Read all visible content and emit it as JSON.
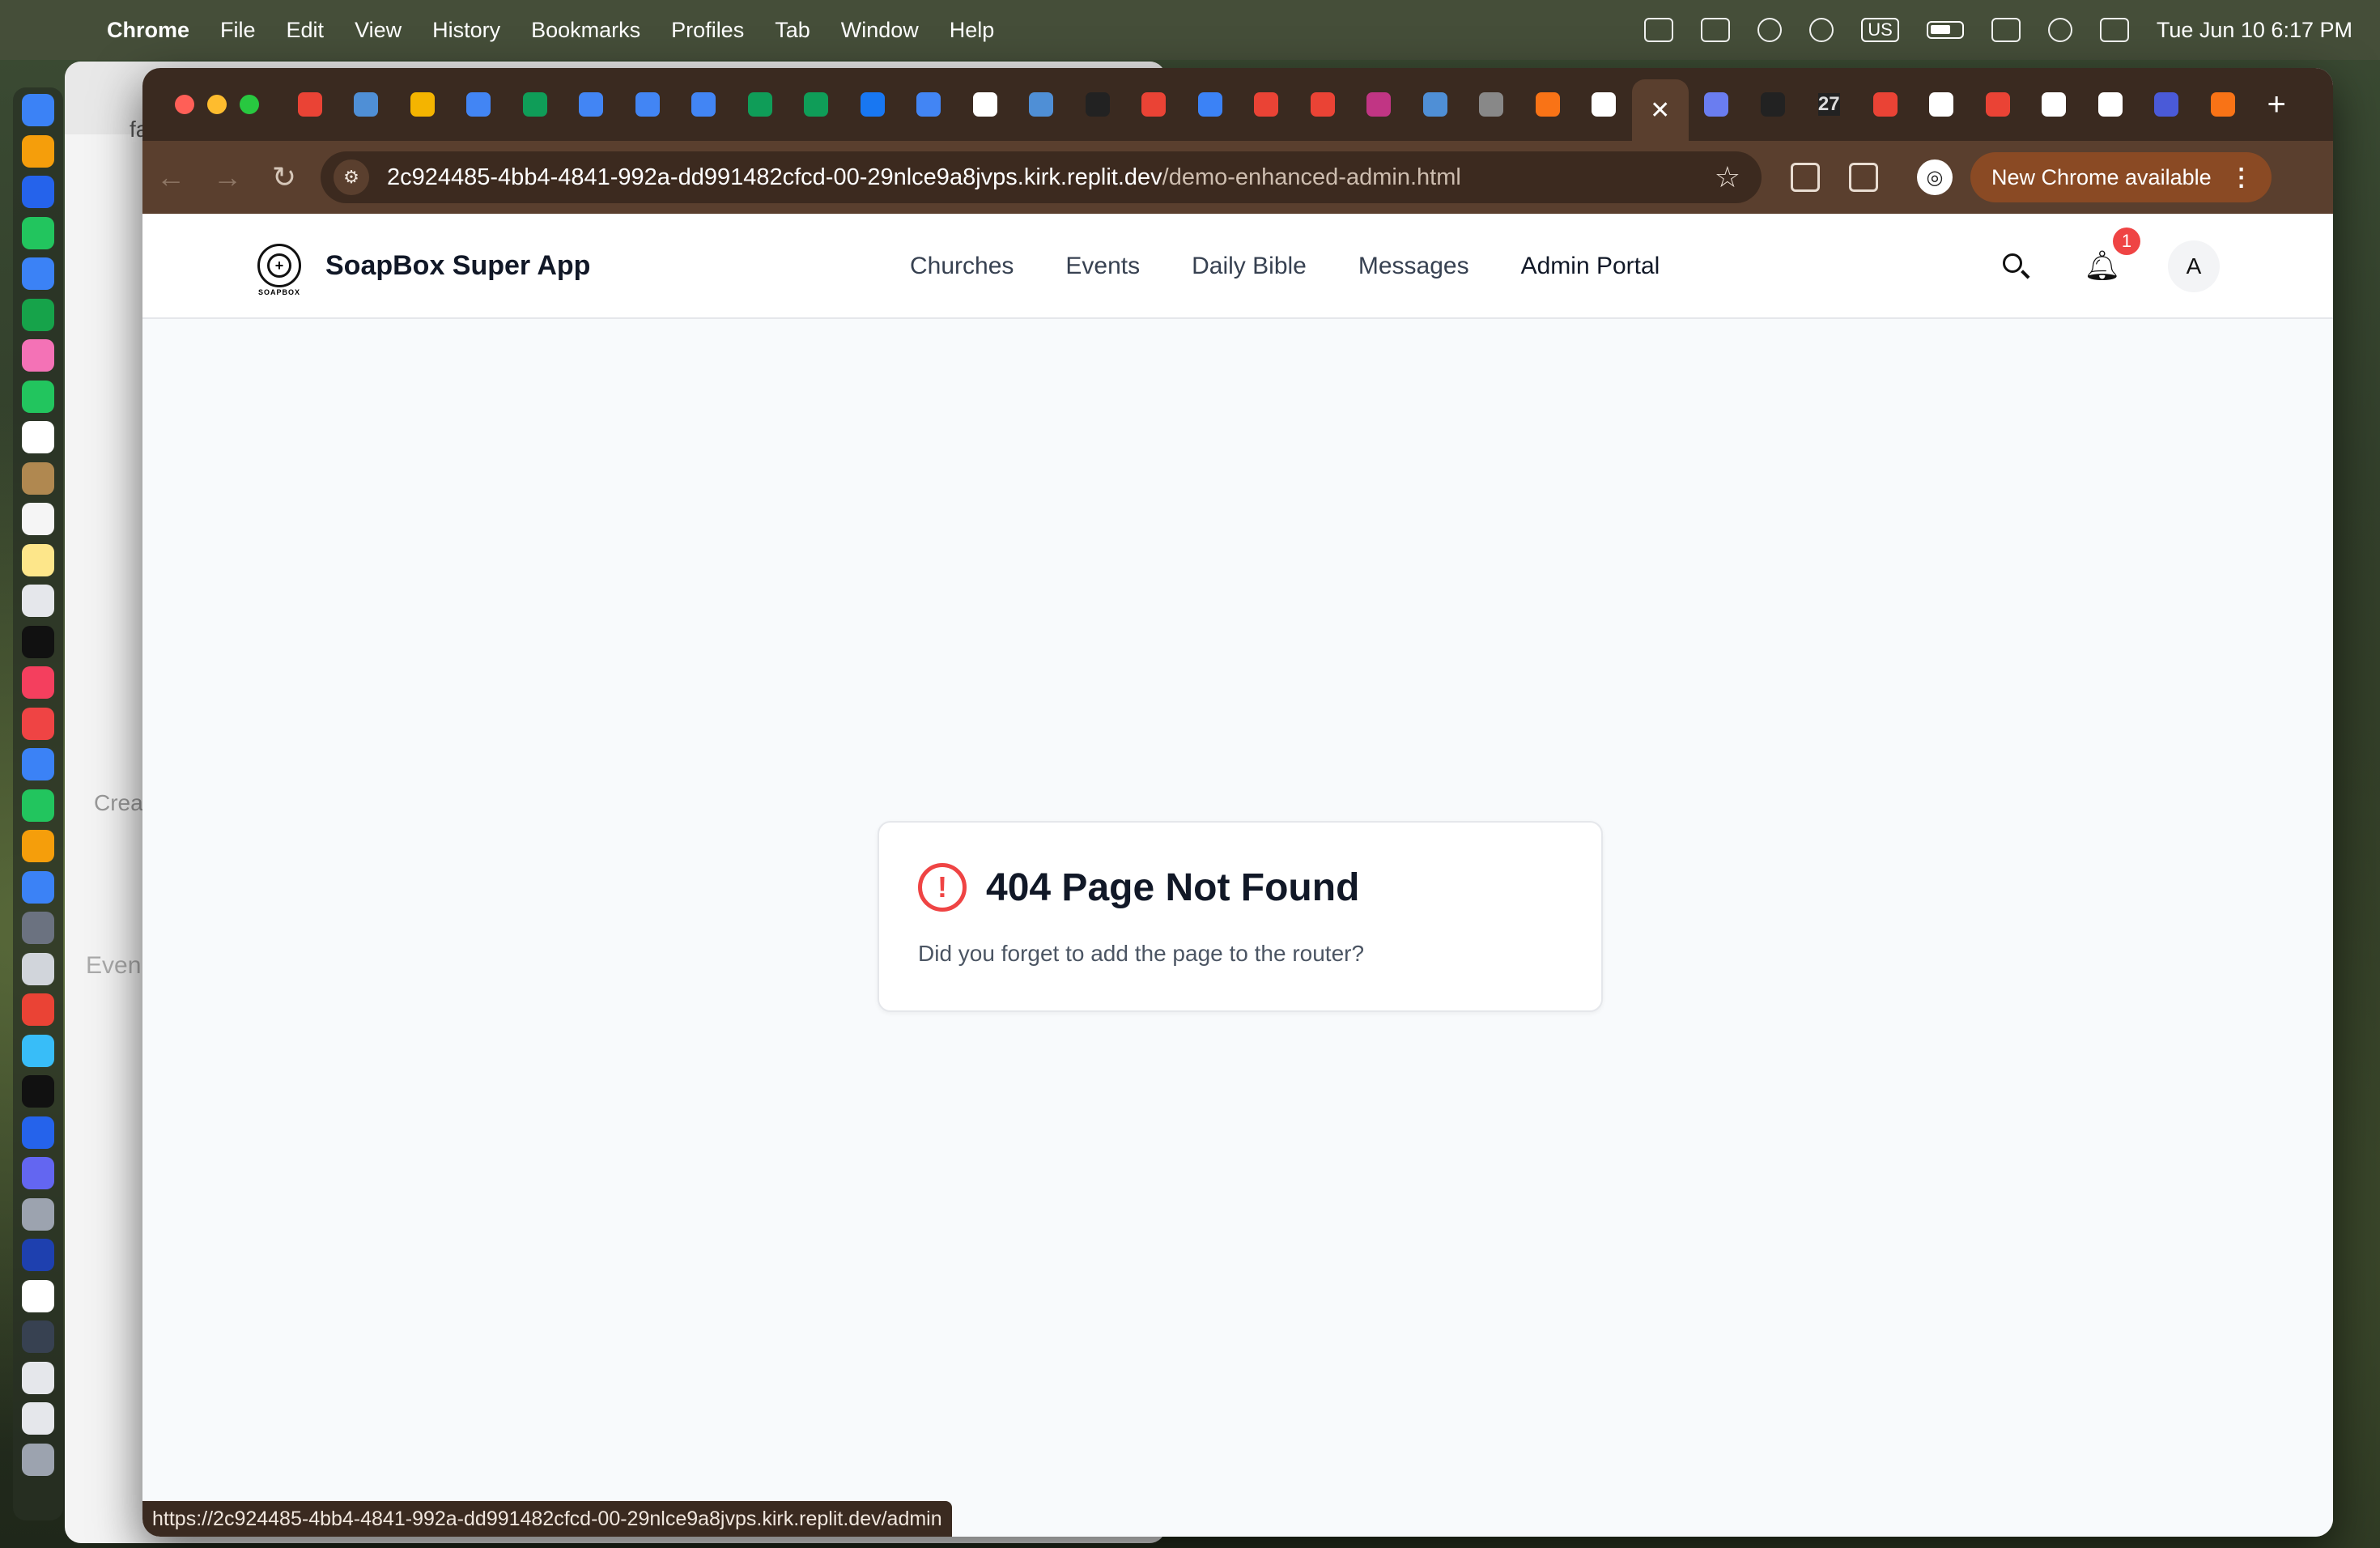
{
  "menubar": {
    "app_name": "Chrome",
    "menus": [
      "File",
      "Edit",
      "View",
      "History",
      "Bookmarks",
      "Profiles",
      "Tab",
      "Window",
      "Help"
    ],
    "keyboard_layout": "US",
    "datetime": "Tue Jun 10  6:17 PM"
  },
  "browser": {
    "tab_favicon_colors": [
      "#ea4335",
      "#4f8fd6",
      "#f4b400",
      "#4285f4",
      "#0f9d58",
      "#4285f4",
      "#4285f4",
      "#4285f4",
      "#0f9d58",
      "#0f9d58",
      "#1877f2",
      "#4285f4",
      "#ffffff",
      "#4f8fd6",
      "#222222",
      "#ea4335",
      "#3b82f6",
      "#ea4335",
      "#ea4335",
      "#c13584",
      "#4f8fd6",
      "#888888",
      "#f97316",
      "#ffffff",
      "#6a7df0",
      "#222222",
      "#ea4335",
      "#ffffff",
      "#ea4335",
      "#ffffff",
      "#ffffff",
      "#4a5ad8",
      "#f97316"
    ],
    "active_tab_close": "✕",
    "new_tab_label": "+",
    "tab_count_label": "27",
    "url_host": "2c924485-4bb4-4841-992a-dd991482cfcd-00-29nlce9a8jvps.kirk.replit.dev",
    "url_path": "/demo-enhanced-admin.html",
    "update_label": "New Chrome available",
    "status_url": "https://2c924485-4bb4-4841-992a-dd991482cfcd-00-29nlce9a8jvps.kirk.replit.dev/admin"
  },
  "site": {
    "logo_text": "SOAPBOX",
    "brand": "SoapBox Super App",
    "nav": [
      "Churches",
      "Events",
      "Daily Bible",
      "Messages",
      "Admin Portal"
    ],
    "notification_count": "1",
    "avatar_initial": "A"
  },
  "error": {
    "title": "404 Page Not Found",
    "message": "Did you forget to add the page to the router?",
    "icon": "alert-circle-icon",
    "color": "#ef4444"
  },
  "background_window": {
    "partial_texts": [
      "fa",
      "Crea",
      "Even"
    ]
  }
}
